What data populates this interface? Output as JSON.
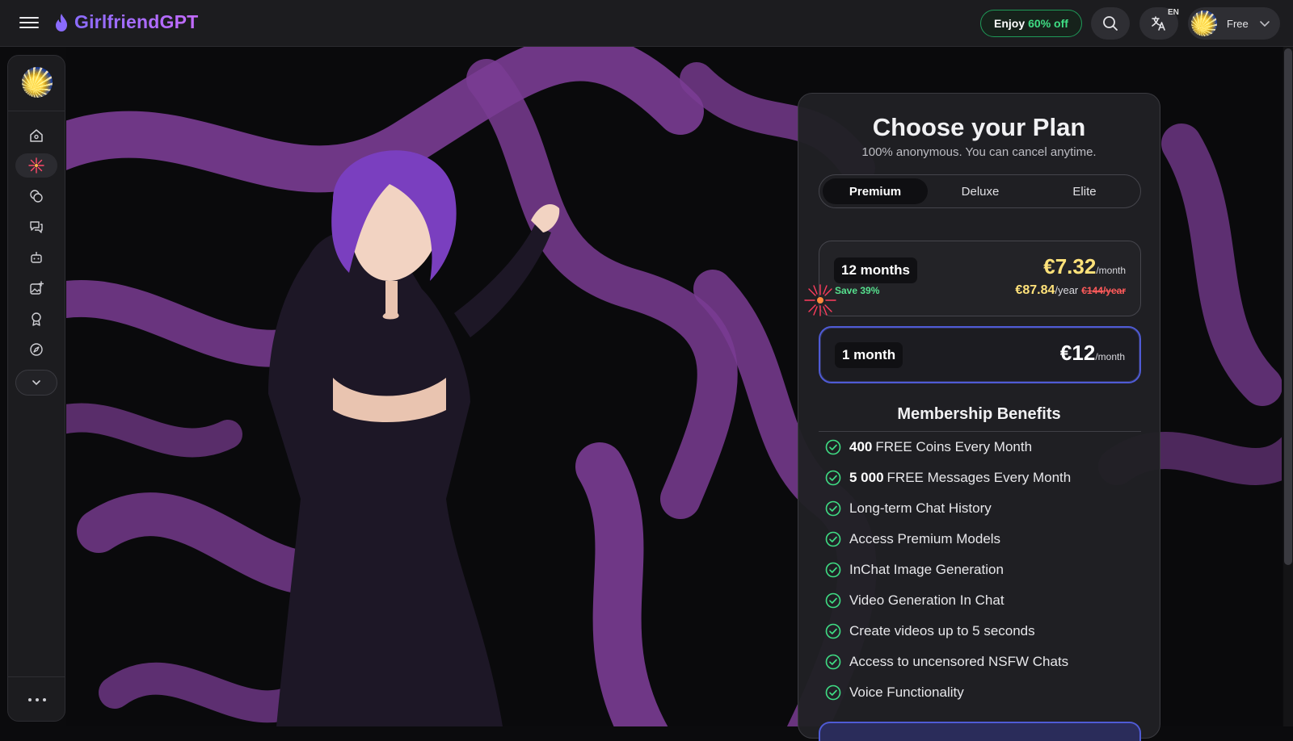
{
  "header": {
    "brand": "GirlfriendGPT",
    "promo_prefix": "Enjoy",
    "promo_highlight": "60% off",
    "lang_code": "EN",
    "user_plan": "Free"
  },
  "sidebar": {
    "items": [
      {
        "icon": "home-icon"
      },
      {
        "icon": "firework-icon",
        "active": true
      },
      {
        "icon": "coins-icon"
      },
      {
        "icon": "chat-icon"
      },
      {
        "icon": "bot-icon"
      },
      {
        "icon": "image-generate-icon"
      },
      {
        "icon": "award-icon"
      },
      {
        "icon": "compass-icon"
      }
    ]
  },
  "plan": {
    "title": "Choose your Plan",
    "subtitle": "100% anonymous. You can cancel anytime.",
    "tabs": [
      "Premium",
      "Deluxe",
      "Elite"
    ],
    "active_tab": "Premium",
    "options": [
      {
        "label": "12 months",
        "save": "Save 39%",
        "price": "€7.32",
        "per": "/month",
        "year_price": "€87.84",
        "year_per": "/year",
        "old_price": "€144/year"
      },
      {
        "label": "1 month",
        "price": "€12",
        "per": "/month",
        "selected": true
      }
    ],
    "benefits_title": "Membership Benefits",
    "benefits": [
      {
        "bold": "400",
        "text": "FREE Coins Every Month"
      },
      {
        "bold": "5 000",
        "text": "FREE Messages Every Month"
      },
      {
        "bold": "",
        "text": "Long-term Chat History"
      },
      {
        "bold": "",
        "text": "Access Premium Models"
      },
      {
        "bold": "",
        "text": "InChat Image Generation"
      },
      {
        "bold": "",
        "text": "Video Generation In Chat"
      },
      {
        "bold": "",
        "text": "Create videos up to 5 seconds"
      },
      {
        "bold": "",
        "text": "Access to uncensored NSFW Chats"
      },
      {
        "bold": "",
        "text": "Voice Functionality"
      }
    ]
  },
  "colors": {
    "brand": "#9a6cff",
    "accent_green": "#3fdd84",
    "price_yellow": "#ffe27a",
    "selected_border": "#4f5bd5",
    "strike_red": "#ff5a5a"
  }
}
